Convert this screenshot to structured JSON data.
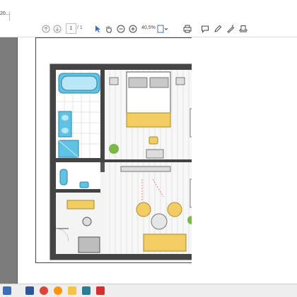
{
  "browser": {
    "tab_label": "20..."
  },
  "toolbar": {
    "page_current": "1",
    "page_total": "/ 1",
    "zoom_level": "40,5%",
    "icons": [
      "arrow-up-icon",
      "arrow-down-icon",
      "cursor-icon",
      "hand-icon",
      "zoom-out-icon",
      "zoom-in-icon",
      "fit-page-icon",
      "print-icon",
      "comment-icon",
      "pen-icon",
      "highlighter-icon",
      "stamp-icon"
    ]
  },
  "taskbar": {
    "apps": [
      "start-icon",
      "word-icon",
      "chrome-icon",
      "firefox-icon",
      "explorer-icon",
      "store-icon",
      "acrobat-icon"
    ]
  },
  "floor_plan": {
    "room_color_bath": "#5fc3e4",
    "furniture_yellow": "#f2cd63",
    "wall_color": "#3c3c3c"
  }
}
